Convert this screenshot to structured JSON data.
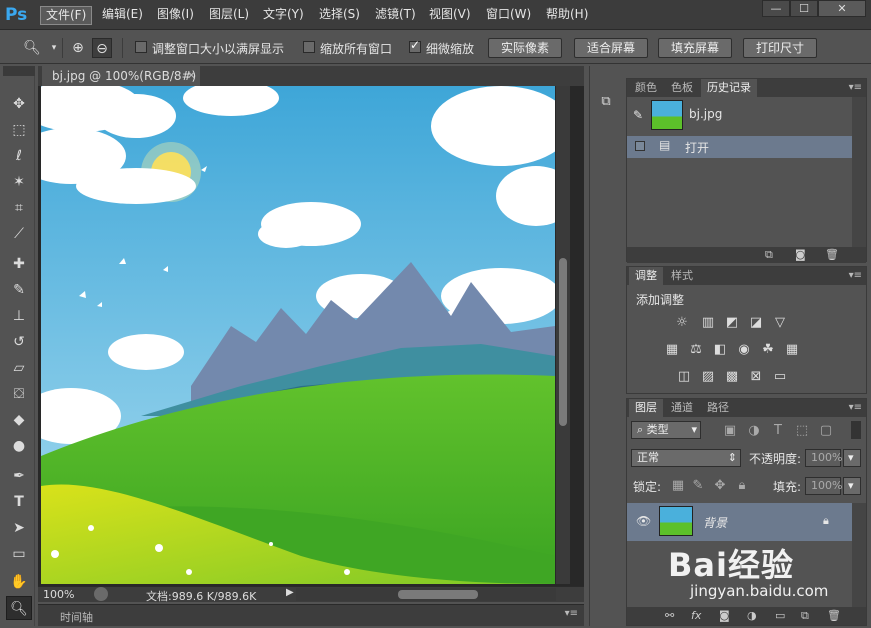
{
  "app": {
    "logo": "Ps"
  },
  "menu": [
    "文件(F)",
    "编辑(E)",
    "图像(I)",
    "图层(L)",
    "文字(Y)",
    "选择(S)",
    "滤镜(T)",
    "视图(V)",
    "窗口(W)",
    "帮助(H)"
  ],
  "window_controls": {
    "minimize": "—",
    "maximize": "☐",
    "close": "✕"
  },
  "options": {
    "resize_windows": "调整窗口大小以满屏显示",
    "zoom_all": "缩放所有窗口",
    "scrubby_zoom": "细微缩放",
    "actual_pixels": "实际像素",
    "fit_screen": "适合屏幕",
    "fill_screen": "填充屏幕",
    "print_size": "打印尺寸",
    "resize_windows_checked": false,
    "zoom_all_checked": false,
    "scrubby_zoom_checked": true
  },
  "document": {
    "tab_title": "bj.jpg @ 100%(RGB/8#)",
    "zoom": "100%",
    "doc_size": "文档:989.6 K/989.6K",
    "timeline": "时间轴"
  },
  "panels": {
    "top_tabs": [
      "颜色",
      "色板",
      "历史记录"
    ],
    "history": {
      "snapshot_name": "bj.jpg",
      "steps": [
        "打开"
      ]
    },
    "mid_tabs": [
      "调整",
      "样式"
    ],
    "adjust_title": "添加调整",
    "layer_tabs": [
      "图层",
      "通道",
      "路径"
    ],
    "layers": {
      "filter_kind": "类型",
      "blend_mode": "正常",
      "opacity_label": "不透明度:",
      "opacity_value": "100%",
      "lock_label": "锁定:",
      "fill_label": "填充:",
      "fill_value": "100%",
      "layer_name": "背景"
    }
  },
  "watermark": {
    "brand": "Bai经验",
    "url": "jingyan.baidu.com"
  },
  "colors": {
    "ps_blue": "#3aa8f0",
    "sky": "#4ab0dc",
    "grass": "#5cc02a",
    "mountain": "#6a7d9e"
  }
}
